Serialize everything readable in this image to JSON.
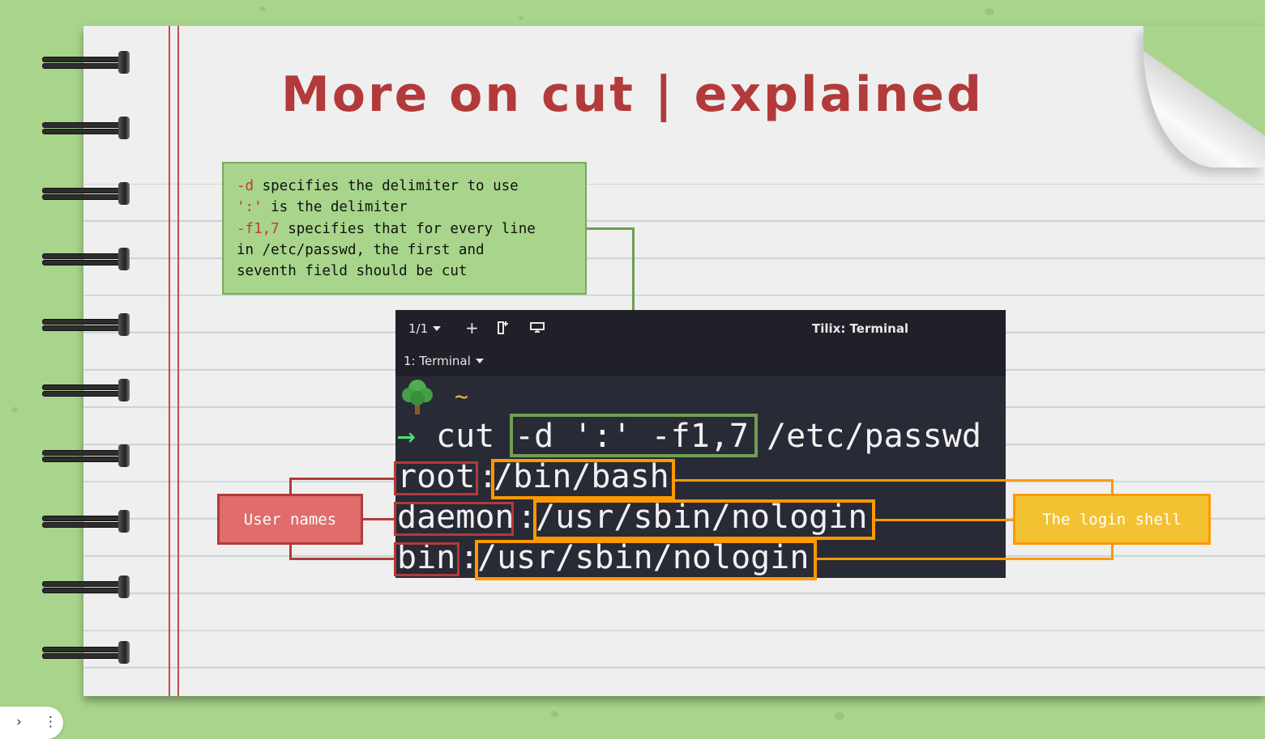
{
  "title": "More on cut | explained",
  "note": {
    "line1_flag": "-d",
    "line1_rest": " specifies the delimiter to use",
    "line2_flag": "':'",
    "line2_rest": " is the delimiter",
    "line3_flag": "-f1,7",
    "line3_rest": " specifies that for every line",
    "line4": "in /etc/passwd, the first and",
    "line5": "seventh field should be cut"
  },
  "terminal": {
    "window_title": "Tilix: Terminal",
    "session_counter": "1/1",
    "tab_label": "1: Terminal",
    "prompt_dir": "~",
    "prompt_arrow": "→",
    "cmd_name": "cut",
    "cmd_options": "-d ':' -f1,7",
    "cmd_file": "/etc/passwd",
    "rows": [
      {
        "user": "root",
        "sep": ":",
        "shell": "/bin/bash"
      },
      {
        "user": "daemon",
        "sep": ":",
        "shell": "/usr/sbin/nologin"
      },
      {
        "user": "bin",
        "sep": ":",
        "shell": "/usr/sbin/nologin"
      }
    ]
  },
  "callouts": {
    "user_names": "User names",
    "login_shell": "The login shell"
  },
  "colors": {
    "background": "#a8d58b",
    "title": "#b23a3a",
    "note_bg": "#a8d58b",
    "user_box": "#e06c6c",
    "shell_box": "#f2c233",
    "orange_outline": "#ff9800",
    "green_outline": "#6f9e56"
  },
  "bottom_bar": {
    "expand_icon": "chevron-right-icon",
    "menu_icon": "more-vertical-icon"
  }
}
